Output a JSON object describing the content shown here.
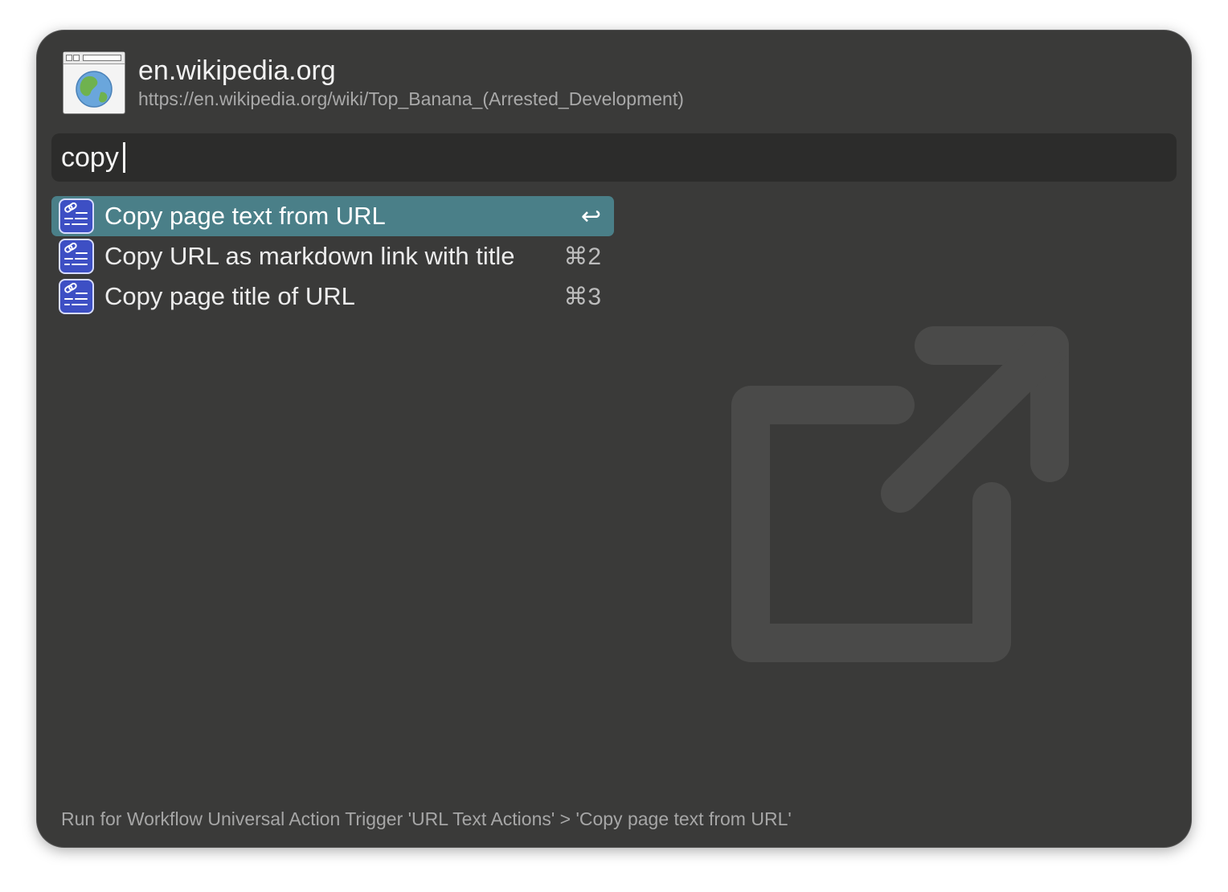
{
  "header": {
    "title": "en.wikipedia.org",
    "url": "https://en.wikipedia.org/wiki/Top_Banana_(Arrested_Development)",
    "icon": "browser-globe-icon"
  },
  "search": {
    "value": "copy"
  },
  "results": [
    {
      "label": "Copy page text from URL",
      "shortcut": "↩",
      "icon": "link-list-icon",
      "selected": true
    },
    {
      "label": "Copy URL as markdown link with title",
      "shortcut": "⌘2",
      "icon": "link-list-icon",
      "selected": false
    },
    {
      "label": "Copy page title of URL",
      "shortcut": "⌘3",
      "icon": "link-list-icon",
      "selected": false
    }
  ],
  "background_icon": "external-link-icon",
  "footer": {
    "text": "Run for Workflow Universal Action Trigger 'URL Text Actions' > 'Copy page text from URL'"
  },
  "colors": {
    "window_bg": "#3a3a39",
    "search_bg": "#2c2c2b",
    "selection": "#4a7f88",
    "icon_bg": "#3d4fc4"
  }
}
